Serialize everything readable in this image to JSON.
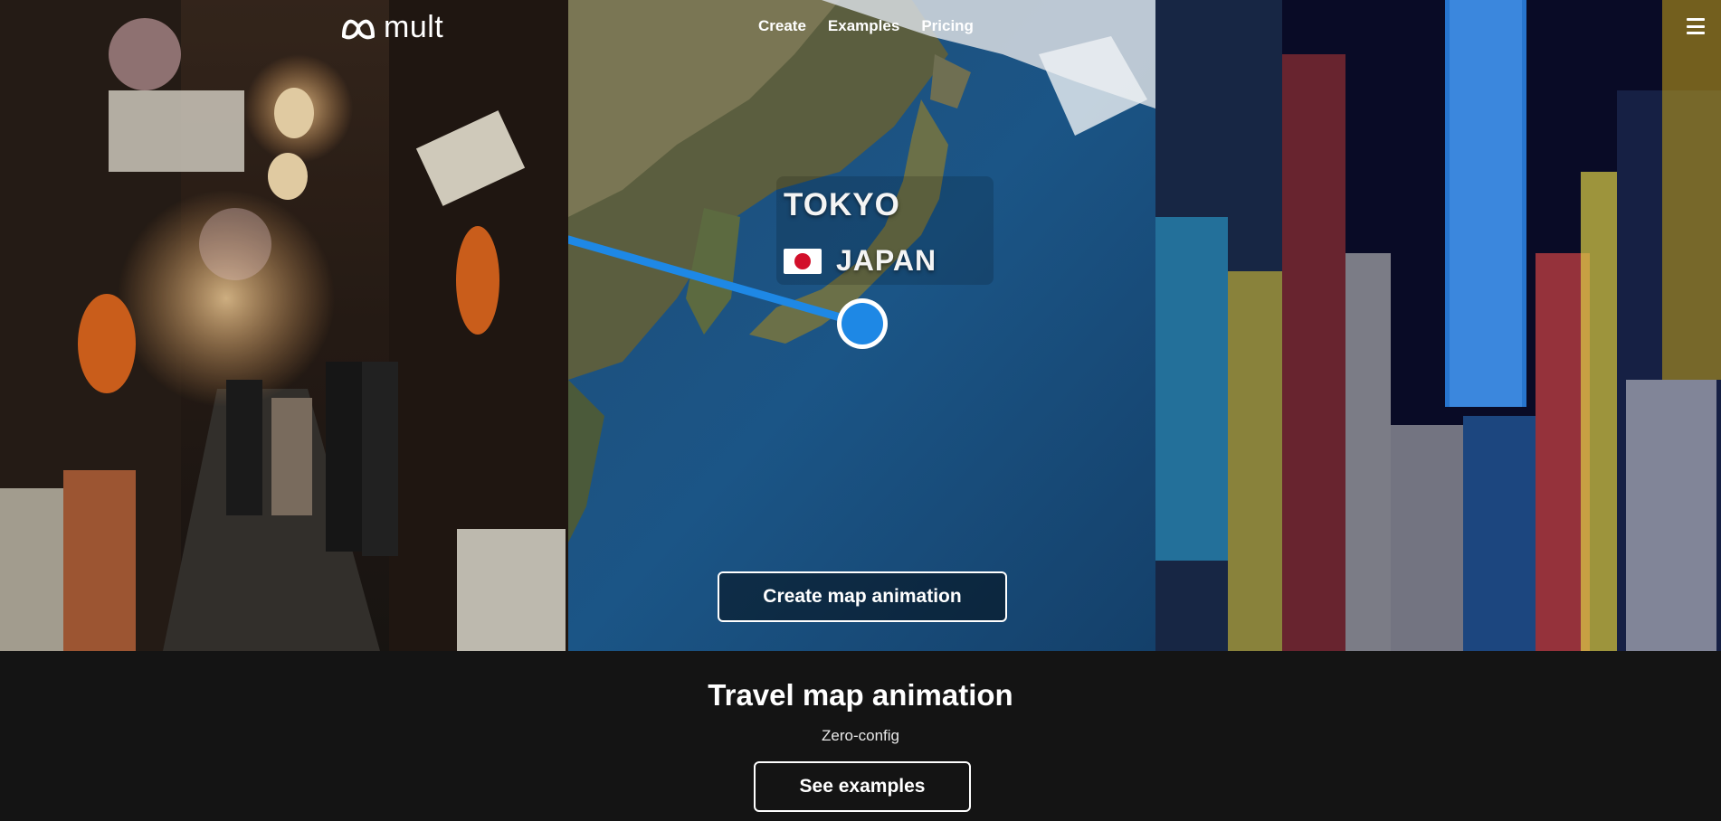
{
  "brand": {
    "name": "mult",
    "logo_icon": "mult-logo-icon"
  },
  "nav": {
    "items": [
      {
        "label": "Create"
      },
      {
        "label": "Examples"
      },
      {
        "label": "Pricing"
      }
    ],
    "menu_icon": "hamburger-menu-icon"
  },
  "hero": {
    "map": {
      "city": "TOKYO",
      "country": "JAPAN",
      "flag_icon": "japan-flag-icon",
      "route_color": "#1e88e5",
      "marker_color": "#1e88e5"
    },
    "cta_label": "Create map animation"
  },
  "section": {
    "title": "Travel map animation",
    "subtitle": "Zero-config",
    "cta_label": "See examples"
  },
  "colors": {
    "page_background": "#141414",
    "accent_blue": "#1e88e5",
    "text": "#ffffff"
  }
}
